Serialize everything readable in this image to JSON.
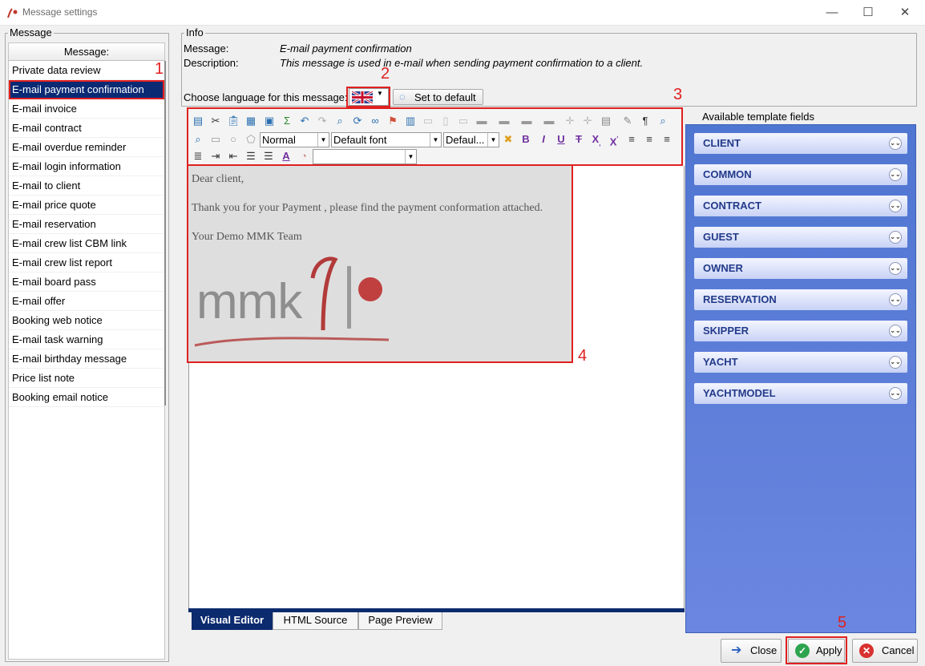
{
  "window": {
    "title": "Message settings",
    "minimize": "—",
    "maximize": "☐",
    "close": "✕"
  },
  "message_panel": {
    "group_title": "Message",
    "header": "Message:",
    "items": [
      "Private data review",
      "E-mail payment confirmation",
      "E-mail invoice",
      "E-mail contract",
      "E-mail overdue reminder",
      "E-mail login information",
      "E-mail to client",
      "E-mail price quote",
      "E-mail reservation",
      "E-mail crew list CBM link",
      "E-mail crew list report",
      "E-mail board pass",
      "E-mail offer",
      "Booking web notice",
      "E-mail task warning",
      "E-mail birthday message",
      "Price list note",
      "Booking email notice"
    ],
    "selected": "E-mail payment confirmation"
  },
  "info": {
    "group_title": "Info",
    "message_label": "Message:",
    "message_value": "E-mail payment confirmation",
    "description_label": "Description:",
    "description_value": "This message is used in e-mail when sending payment confirmation to a client.",
    "language_label": "Choose language for this message:",
    "set_default_label": "Set to default"
  },
  "toolbar": {
    "style_select": "Normal",
    "font_select": "Default font",
    "size_select": "Defaul..."
  },
  "editor": {
    "line1": "Dear client,",
    "line2": "Thank you for your Payment , please find the payment conformation attached.",
    "line3": "Your Demo MMK Team",
    "logo_text": "mmk"
  },
  "editor_tabs": [
    "Visual Editor",
    "HTML Source",
    "Page Preview"
  ],
  "template_fields": {
    "title": "Available template fields",
    "items": [
      "CLIENT",
      "COMMON",
      "CONTRACT",
      "GUEST",
      "OWNER",
      "RESERVATION",
      "SKIPPER",
      "YACHT",
      "YACHTMODEL"
    ]
  },
  "buttons": {
    "close": "Close",
    "apply": "Apply",
    "cancel": "Cancel"
  },
  "annotations": [
    "1",
    "2",
    "3",
    "4",
    "5"
  ],
  "colors": {
    "selection": "#0b2a74",
    "annotation_red": "#e02020",
    "fields_panel": "#5a7ad8"
  }
}
